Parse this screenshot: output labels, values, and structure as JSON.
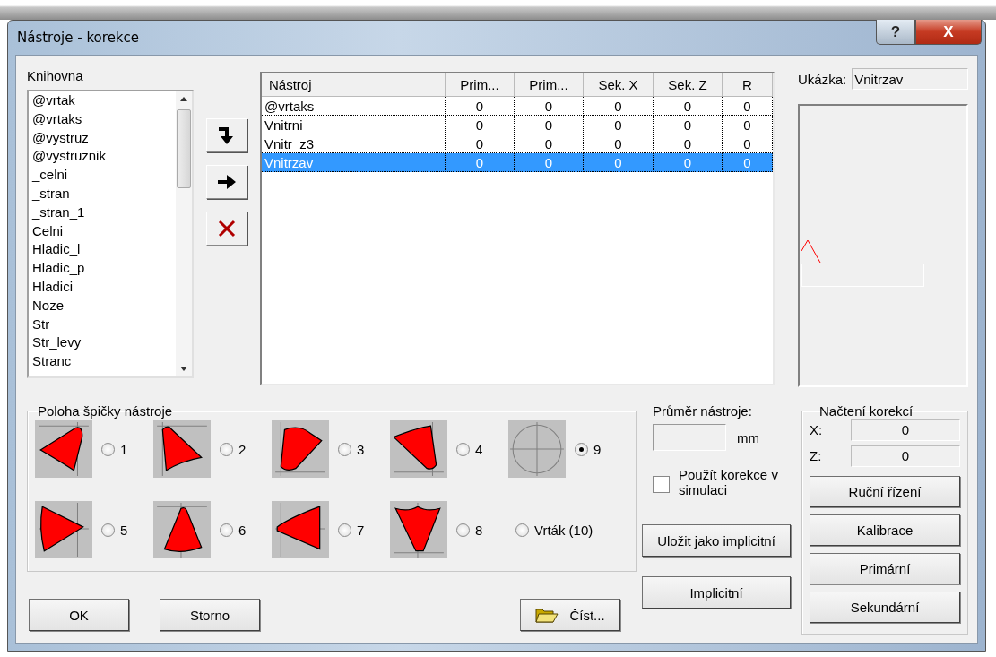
{
  "window": {
    "title": "Nástroje - korekce",
    "help": "?",
    "close": "X"
  },
  "library": {
    "label": "Knihovna",
    "items": [
      "@vrtak",
      "@vrtaks",
      "@vystruz",
      "@vystruznik",
      "_celni",
      "_stran",
      "_stran_1",
      "Celni",
      "Hladic_l",
      "Hladic_p",
      "Hladici",
      "Noze",
      "Str",
      "Str_levy",
      "Stranc"
    ]
  },
  "table": {
    "columns": [
      "Nástroj",
      "Prim...",
      "Prim...",
      "Sek. X",
      "Sek. Z",
      "R"
    ],
    "rows": [
      {
        "cells": [
          "@vrtaks",
          "0",
          "0",
          "0",
          "0",
          "0"
        ],
        "selected": false
      },
      {
        "cells": [
          "Vnitrni",
          "0",
          "0",
          "0",
          "0",
          "0"
        ],
        "selected": false
      },
      {
        "cells": [
          "Vnitr_z3",
          "0",
          "0",
          "0",
          "0",
          "0"
        ],
        "selected": false
      },
      {
        "cells": [
          "Vnitrzav",
          "0",
          "0",
          "0",
          "0",
          "0"
        ],
        "selected": true
      }
    ]
  },
  "preview": {
    "label": "Ukázka:",
    "value": "Vnitrzav"
  },
  "tip_position": {
    "title": "Poloha špičky nástroje",
    "options": [
      {
        "label": "1",
        "selected": false,
        "kind": "shape"
      },
      {
        "label": "2",
        "selected": false,
        "kind": "shape"
      },
      {
        "label": "3",
        "selected": false,
        "kind": "shape"
      },
      {
        "label": "4",
        "selected": false,
        "kind": "shape"
      },
      {
        "label": "9",
        "selected": true,
        "kind": "circle"
      },
      {
        "label": "5",
        "selected": false,
        "kind": "shape"
      },
      {
        "label": "6",
        "selected": false,
        "kind": "shape"
      },
      {
        "label": "7",
        "selected": false,
        "kind": "shape"
      },
      {
        "label": "8",
        "selected": false,
        "kind": "shape"
      },
      {
        "label": "Vrták (10)",
        "selected": false,
        "kind": "plain"
      }
    ]
  },
  "diameter": {
    "label": "Průměr nástroje:",
    "unit": "mm"
  },
  "simulation": {
    "label": "Použít korekce v simulaci",
    "checked": false
  },
  "corrections": {
    "title": "Načtení korekcí",
    "x_label": "X:",
    "x_value": "0",
    "z_label": "Z:",
    "z_value": "0",
    "buttons": [
      "Ruční řízení",
      "Kalibrace",
      "Primární",
      "Sekundární"
    ]
  },
  "buttons": {
    "save_default": "Uložit jako implicitní",
    "ok": "OK",
    "cancel": "Storno",
    "read": "Číst...",
    "default": "Implicitní"
  }
}
